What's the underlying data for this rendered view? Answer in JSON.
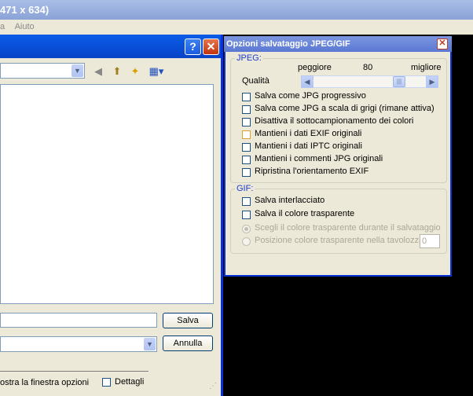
{
  "background_window": {
    "title_fragment": "471 x 634)",
    "menu": [
      "a",
      "Aiuto"
    ]
  },
  "save_dialog": {
    "save_button": "Salva",
    "cancel_button": "Annulla",
    "show_options_text": "ostra la finestra opzioni",
    "details_label": "Dettagli",
    "details_checked": false,
    "toolbar_icons": [
      "back-icon",
      "up-folder-icon",
      "new-folder-icon",
      "view-menu-icon"
    ]
  },
  "options_dialog": {
    "title": "Opzioni salvataggio JPEG/GIF",
    "jpeg_group": {
      "label": "JPEG:",
      "quality_label": "Qualità",
      "worse_label": "peggiore",
      "better_label": "migliore",
      "quality_value": "80",
      "checkboxes": [
        {
          "label": "Salva come JPG progressivo",
          "checked": false
        },
        {
          "label": "Salva come JPG a scala di grigi (rimane attiva)",
          "checked": false
        },
        {
          "label": "Disattiva il sottocampionamento dei colori",
          "checked": false
        },
        {
          "label": "Mantieni i dati EXIF originali",
          "checked": false
        },
        {
          "label": "Mantieni i dati IPTC originali",
          "checked": false
        },
        {
          "label": "Mantieni i commenti JPG originali",
          "checked": false
        },
        {
          "label": "Ripristina l'orientamento EXIF",
          "checked": false
        }
      ]
    },
    "gif_group": {
      "label": "GIF:",
      "checkboxes": [
        {
          "label": "Salva interlacciato",
          "checked": false
        },
        {
          "label": "Salva il colore trasparente",
          "checked": false
        }
      ],
      "radios": [
        {
          "label": "Scegli il colore trasparente durante il salvataggio",
          "selected": true
        },
        {
          "label": "Posizione colore trasparente nella tavolozza:",
          "selected": false
        }
      ],
      "palette_position_value": "0"
    }
  }
}
